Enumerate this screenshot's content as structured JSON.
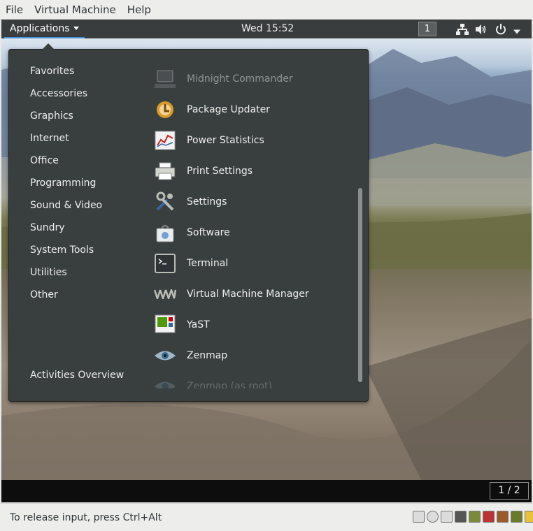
{
  "host_menu": [
    "File",
    "Virtual Machine",
    "Help"
  ],
  "top_panel": {
    "applications_label": "Applications",
    "clock": "Wed 15:52",
    "workspace_number": "1",
    "tray_icons": [
      "network-icon",
      "volume-icon",
      "power-icon",
      "chevron-down-icon"
    ]
  },
  "apps_menu": {
    "categories": [
      "Favorites",
      "Accessories",
      "Graphics",
      "Internet",
      "Office",
      "Programming",
      "Sound & Video",
      "Sundry",
      "System Tools",
      "Utilities",
      "Other"
    ],
    "activities_label": "Activities Overview",
    "apps": [
      {
        "label": "Midnight Commander",
        "icon": "midnight-commander-icon"
      },
      {
        "label": "Package Updater",
        "icon": "package-updater-icon"
      },
      {
        "label": "Power Statistics",
        "icon": "power-statistics-icon"
      },
      {
        "label": "Print Settings",
        "icon": "printer-icon"
      },
      {
        "label": "Settings",
        "icon": "settings-tools-icon"
      },
      {
        "label": "Software",
        "icon": "software-bag-icon"
      },
      {
        "label": "Terminal",
        "icon": "terminal-icon"
      },
      {
        "label": "Virtual Machine Manager",
        "icon": "vmm-icon"
      },
      {
        "label": "YaST",
        "icon": "yast-icon"
      },
      {
        "label": "Zenmap",
        "icon": "eye-icon"
      },
      {
        "label": "Zenmap (as root)",
        "icon": "eye-icon"
      }
    ]
  },
  "bottom_bar": {
    "page_indicator": "1 / 2"
  },
  "host_status": {
    "message": "To release input, press Ctrl+Alt",
    "icons": [
      "hdd-icon",
      "cdrom-icon",
      "usb-icon",
      "network-card-icon",
      "display-icon",
      "disconnect-icon",
      "audio-disconnect-icon",
      "serial-icon",
      "keyboard-capture-icon"
    ]
  },
  "colors": {
    "panel": "#3a3d3e",
    "menu": "#393f3f",
    "accent": "#4a90d9",
    "host_chrome": "#ededec"
  }
}
